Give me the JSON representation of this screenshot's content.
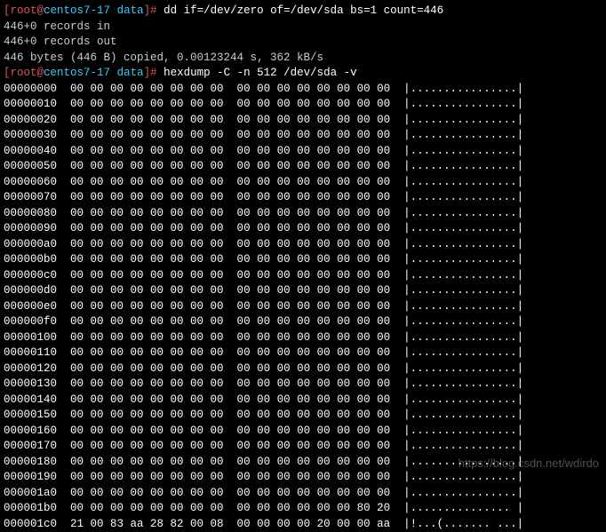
{
  "prompt1": {
    "open": "[",
    "user": "root",
    "at": "@",
    "host": "centos7-17 ",
    "path": "data",
    "close": "]# ",
    "cmd": "dd if=/dev/zero of=/dev/sda bs=1 count=446"
  },
  "dd_out": {
    "l1": "446+0 records in",
    "l2": "446+0 records out",
    "l3": "446 bytes (446 B) copied, 0.00123244 s, 362 kB/s"
  },
  "prompt2": {
    "open": "[",
    "user": "root",
    "at": "@",
    "host": "centos7-17 ",
    "path": "data",
    "close": "]# ",
    "cmd": "hexdump -C -n 512 /dev/sda -v"
  },
  "hex_lines": [
    {
      "off": "00000000",
      "b": "00 00 00 00 00 00 00 00  00 00 00 00 00 00 00 00",
      "a": "|................|"
    },
    {
      "off": "00000010",
      "b": "00 00 00 00 00 00 00 00  00 00 00 00 00 00 00 00",
      "a": "|................|"
    },
    {
      "off": "00000020",
      "b": "00 00 00 00 00 00 00 00  00 00 00 00 00 00 00 00",
      "a": "|................|"
    },
    {
      "off": "00000030",
      "b": "00 00 00 00 00 00 00 00  00 00 00 00 00 00 00 00",
      "a": "|................|"
    },
    {
      "off": "00000040",
      "b": "00 00 00 00 00 00 00 00  00 00 00 00 00 00 00 00",
      "a": "|................|"
    },
    {
      "off": "00000050",
      "b": "00 00 00 00 00 00 00 00  00 00 00 00 00 00 00 00",
      "a": "|................|"
    },
    {
      "off": "00000060",
      "b": "00 00 00 00 00 00 00 00  00 00 00 00 00 00 00 00",
      "a": "|................|"
    },
    {
      "off": "00000070",
      "b": "00 00 00 00 00 00 00 00  00 00 00 00 00 00 00 00",
      "a": "|................|"
    },
    {
      "off": "00000080",
      "b": "00 00 00 00 00 00 00 00  00 00 00 00 00 00 00 00",
      "a": "|................|"
    },
    {
      "off": "00000090",
      "b": "00 00 00 00 00 00 00 00  00 00 00 00 00 00 00 00",
      "a": "|................|"
    },
    {
      "off": "000000a0",
      "b": "00 00 00 00 00 00 00 00  00 00 00 00 00 00 00 00",
      "a": "|................|"
    },
    {
      "off": "000000b0",
      "b": "00 00 00 00 00 00 00 00  00 00 00 00 00 00 00 00",
      "a": "|................|"
    },
    {
      "off": "000000c0",
      "b": "00 00 00 00 00 00 00 00  00 00 00 00 00 00 00 00",
      "a": "|................|"
    },
    {
      "off": "000000d0",
      "b": "00 00 00 00 00 00 00 00  00 00 00 00 00 00 00 00",
      "a": "|................|"
    },
    {
      "off": "000000e0",
      "b": "00 00 00 00 00 00 00 00  00 00 00 00 00 00 00 00",
      "a": "|................|"
    },
    {
      "off": "000000f0",
      "b": "00 00 00 00 00 00 00 00  00 00 00 00 00 00 00 00",
      "a": "|................|"
    },
    {
      "off": "00000100",
      "b": "00 00 00 00 00 00 00 00  00 00 00 00 00 00 00 00",
      "a": "|................|"
    },
    {
      "off": "00000110",
      "b": "00 00 00 00 00 00 00 00  00 00 00 00 00 00 00 00",
      "a": "|................|"
    },
    {
      "off": "00000120",
      "b": "00 00 00 00 00 00 00 00  00 00 00 00 00 00 00 00",
      "a": "|................|"
    },
    {
      "off": "00000130",
      "b": "00 00 00 00 00 00 00 00  00 00 00 00 00 00 00 00",
      "a": "|................|"
    },
    {
      "off": "00000140",
      "b": "00 00 00 00 00 00 00 00  00 00 00 00 00 00 00 00",
      "a": "|................|"
    },
    {
      "off": "00000150",
      "b": "00 00 00 00 00 00 00 00  00 00 00 00 00 00 00 00",
      "a": "|................|"
    },
    {
      "off": "00000160",
      "b": "00 00 00 00 00 00 00 00  00 00 00 00 00 00 00 00",
      "a": "|................|"
    },
    {
      "off": "00000170",
      "b": "00 00 00 00 00 00 00 00  00 00 00 00 00 00 00 00",
      "a": "|................|"
    },
    {
      "off": "00000180",
      "b": "00 00 00 00 00 00 00 00  00 00 00 00 00 00 00 00",
      "a": "|................|"
    },
    {
      "off": "00000190",
      "b": "00 00 00 00 00 00 00 00  00 00 00 00 00 00 00 00",
      "a": "|................|"
    },
    {
      "off": "000001a0",
      "b": "00 00 00 00 00 00 00 00  00 00 00 00 00 00 00 00",
      "a": "|................|"
    },
    {
      "off": "000001b0",
      "b": "00 00 00 00 00 00 00 00  00 00 00 00 00 00 80 20",
      "a": "|............... |"
    },
    {
      "off": "000001c0",
      "b": "21 00 83 aa 28 82 00 08  00 00 00 00 20 00 00 aa",
      "a": "|!...(....... ...|"
    }
  ],
  "watermark": "https://blog.csdn.net/wdirdo"
}
